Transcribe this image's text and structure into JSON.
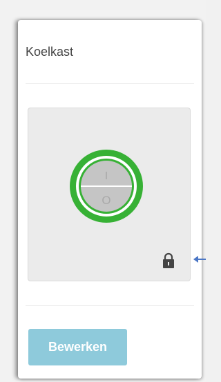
{
  "widget": {
    "title": "Koelkast",
    "switch_state": "on",
    "switch_on_label": "I",
    "switch_off_label": "O",
    "locked": true,
    "edit_label": "Bewerken"
  },
  "icons": {
    "switch": "power-toggle-icon",
    "lock": "lock-icon",
    "annotation": "arrow-left-icon"
  },
  "colors": {
    "switch_ring": "#37b135",
    "button_bg": "#8ecadb",
    "annotation_arrow": "#4a76c5"
  }
}
